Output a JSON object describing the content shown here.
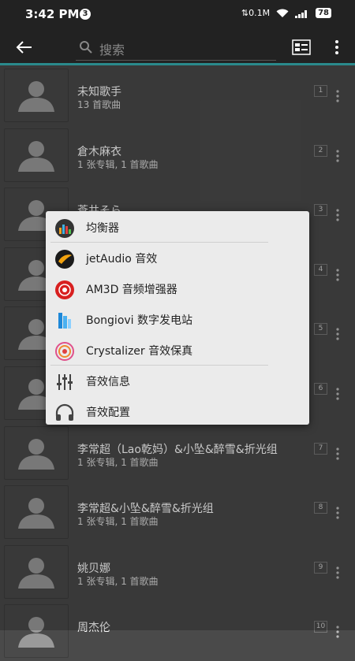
{
  "status_bar": {
    "time": "3:42 PM",
    "notification_count": "3",
    "net_speed": "0.1M",
    "battery": "78"
  },
  "toolbar": {
    "search_placeholder": "搜索"
  },
  "artists": [
    {
      "name": "未知歌手",
      "detail": "13 首歌曲",
      "index": "1"
    },
    {
      "name": "倉木麻衣",
      "detail": "1 张专辑, 1 首歌曲",
      "index": "2"
    },
    {
      "name": "蒼井そら",
      "detail": "",
      "index": "3"
    },
    {
      "name": "",
      "detail": "",
      "index": "4"
    },
    {
      "name": "",
      "detail": "",
      "index": "5"
    },
    {
      "name": "",
      "detail": "",
      "index": "6"
    },
    {
      "name": "李常超（Lao乾妈）&小坠&醉雪&折光组",
      "detail": "1 张专辑, 1 首歌曲",
      "index": "7"
    },
    {
      "name": "李常超&小坠&醉雪&折光组",
      "detail": "1 张专辑, 1 首歌曲",
      "index": "8"
    },
    {
      "name": "姚贝娜",
      "detail": "1 张专辑, 1 首歌曲",
      "index": "9"
    },
    {
      "name": "周杰伦",
      "detail": "",
      "index": "10"
    }
  ],
  "popup_menu": {
    "items": [
      {
        "label": "均衡器",
        "icon": "equalizer-icon"
      },
      {
        "label": "jetAudio 音效",
        "icon": "jetaudio-icon"
      },
      {
        "label": "AM3D 音频增强器",
        "icon": "am3d-icon"
      },
      {
        "label": "Bongiovi 数字发电站",
        "icon": "bongiovi-icon"
      },
      {
        "label": "Crystalizer 音效保真",
        "icon": "crystalizer-icon"
      },
      {
        "label": "音效信息",
        "icon": "sliders-icon"
      },
      {
        "label": "音效配置",
        "icon": "headphones-icon"
      }
    ]
  },
  "colors": {
    "accent": "#2a8a8c",
    "background": "#4a4a4a",
    "toolbar": "#222222",
    "popup": "#ebebeb"
  }
}
